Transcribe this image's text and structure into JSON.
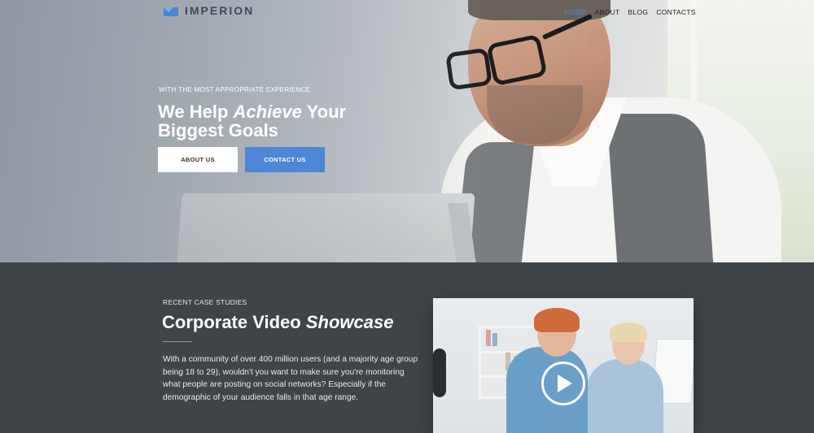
{
  "brand": {
    "name": "IMPERION",
    "accent": "#4f86d6"
  },
  "nav": {
    "items": [
      {
        "label": "HOME",
        "active": true
      },
      {
        "label": "ABOUT",
        "active": false
      },
      {
        "label": "BLOG",
        "active": false
      },
      {
        "label": "CONTACTS",
        "active": false
      }
    ]
  },
  "hero": {
    "eyebrow": "WITH THE MOST APPROPRIATE EXPERIENCE",
    "headline_part1": "We Help ",
    "headline_em": "Achieve",
    "headline_part2": " Your Biggest Goals",
    "buttons": {
      "about": "ABOUT US",
      "contact": "CONTACT US"
    }
  },
  "case_studies": {
    "eyebrow": "RECENT CASE STUDIES",
    "title_part1": "Corporate Video ",
    "title_em": "Showcase",
    "body": "With a community of over 400 million users (and a majority age group being 18 to 29), wouldn't you want to make sure you're monitoring what people are posting on social networks? Especially if the demographic of your audience falls in that age range."
  },
  "video": {
    "icon": "play-icon"
  }
}
